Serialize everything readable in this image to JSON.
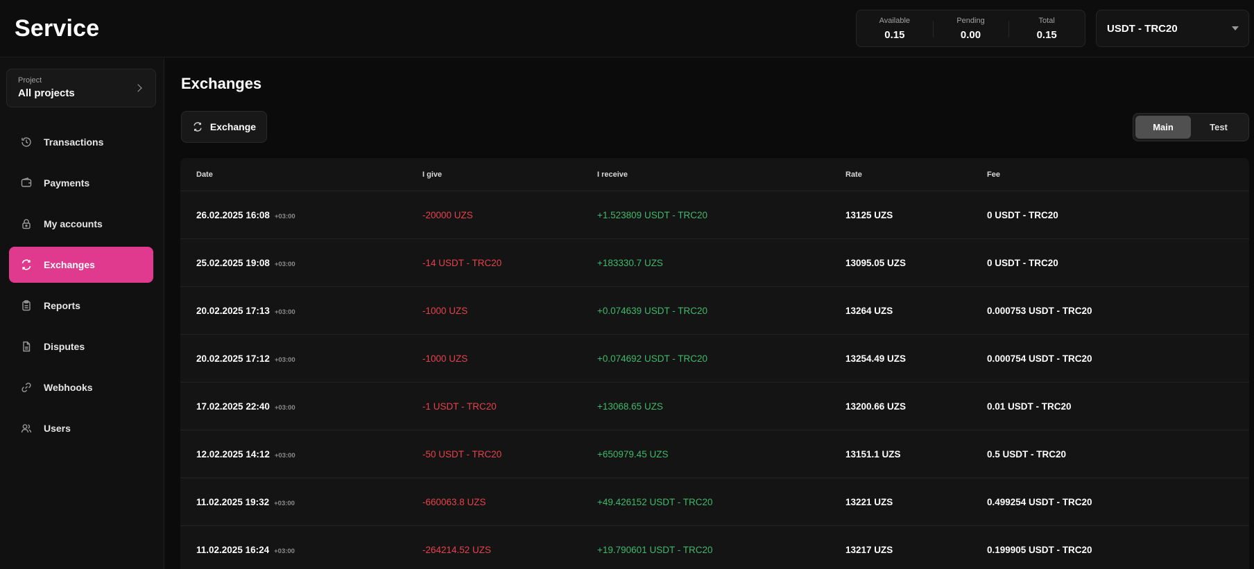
{
  "header": {
    "logo": "Service",
    "balances": [
      {
        "label": "Available",
        "value": "0.15"
      },
      {
        "label": "Pending",
        "value": "0.00"
      },
      {
        "label": "Total",
        "value": "0.15"
      }
    ],
    "currency": "USDT - TRC20"
  },
  "sidebar": {
    "project_label": "Project",
    "project_value": "All projects",
    "items": [
      {
        "label": "Transactions",
        "icon": "history-icon"
      },
      {
        "label": "Payments",
        "icon": "wallet-icon"
      },
      {
        "label": "My accounts",
        "icon": "lock-icon"
      },
      {
        "label": "Exchanges",
        "icon": "exchange-icon",
        "active": true
      },
      {
        "label": "Reports",
        "icon": "clipboard-icon"
      },
      {
        "label": "Disputes",
        "icon": "document-icon"
      },
      {
        "label": "Webhooks",
        "icon": "link-icon"
      },
      {
        "label": "Users",
        "icon": "users-icon"
      }
    ]
  },
  "main": {
    "title": "Exchanges",
    "exchange_button": "Exchange",
    "toggle": {
      "options": [
        "Main",
        "Test"
      ],
      "active": "Main"
    },
    "columns": [
      "Date",
      "I give",
      "I receive",
      "Rate",
      "Fee"
    ],
    "rows": [
      {
        "date": "26.02.2025  16:08",
        "tz": "+03:00",
        "give": "-20000 UZS",
        "receive": "+1.523809 USDT - TRC20",
        "rate": "13125 UZS",
        "fee": "0 USDT - TRC20"
      },
      {
        "date": "25.02.2025  19:08",
        "tz": "+03:00",
        "give": "-14 USDT - TRC20",
        "receive": "+183330.7 UZS",
        "rate": "13095.05 UZS",
        "fee": "0 USDT - TRC20"
      },
      {
        "date": "20.02.2025  17:13",
        "tz": "+03:00",
        "give": "-1000 UZS",
        "receive": "+0.074639 USDT - TRC20",
        "rate": "13264 UZS",
        "fee": "0.000753 USDT - TRC20"
      },
      {
        "date": "20.02.2025  17:12",
        "tz": "+03:00",
        "give": "-1000 UZS",
        "receive": "+0.074692 USDT - TRC20",
        "rate": "13254.49 UZS",
        "fee": "0.000754 USDT - TRC20"
      },
      {
        "date": "17.02.2025  22:40",
        "tz": "+03:00",
        "give": "-1 USDT - TRC20",
        "receive": "+13068.65 UZS",
        "rate": "13200.66 UZS",
        "fee": "0.01 USDT - TRC20"
      },
      {
        "date": "12.02.2025  14:12",
        "tz": "+03:00",
        "give": "-50 USDT - TRC20",
        "receive": "+650979.45 UZS",
        "rate": "13151.1 UZS",
        "fee": "0.5 USDT - TRC20"
      },
      {
        "date": "11.02.2025  19:32",
        "tz": "+03:00",
        "give": "-660063.8 UZS",
        "receive": "+49.426152 USDT - TRC20",
        "rate": "13221 UZS",
        "fee": "0.499254 USDT - TRC20"
      },
      {
        "date": "11.02.2025  16:24",
        "tz": "+03:00",
        "give": "-264214.52 UZS",
        "receive": "+19.790601 USDT - TRC20",
        "rate": "13217 UZS",
        "fee": "0.199905 USDT - TRC20"
      }
    ]
  },
  "colors": {
    "accent": "#e03a8e",
    "negative": "#e8414b",
    "positive": "#3fb96b"
  }
}
